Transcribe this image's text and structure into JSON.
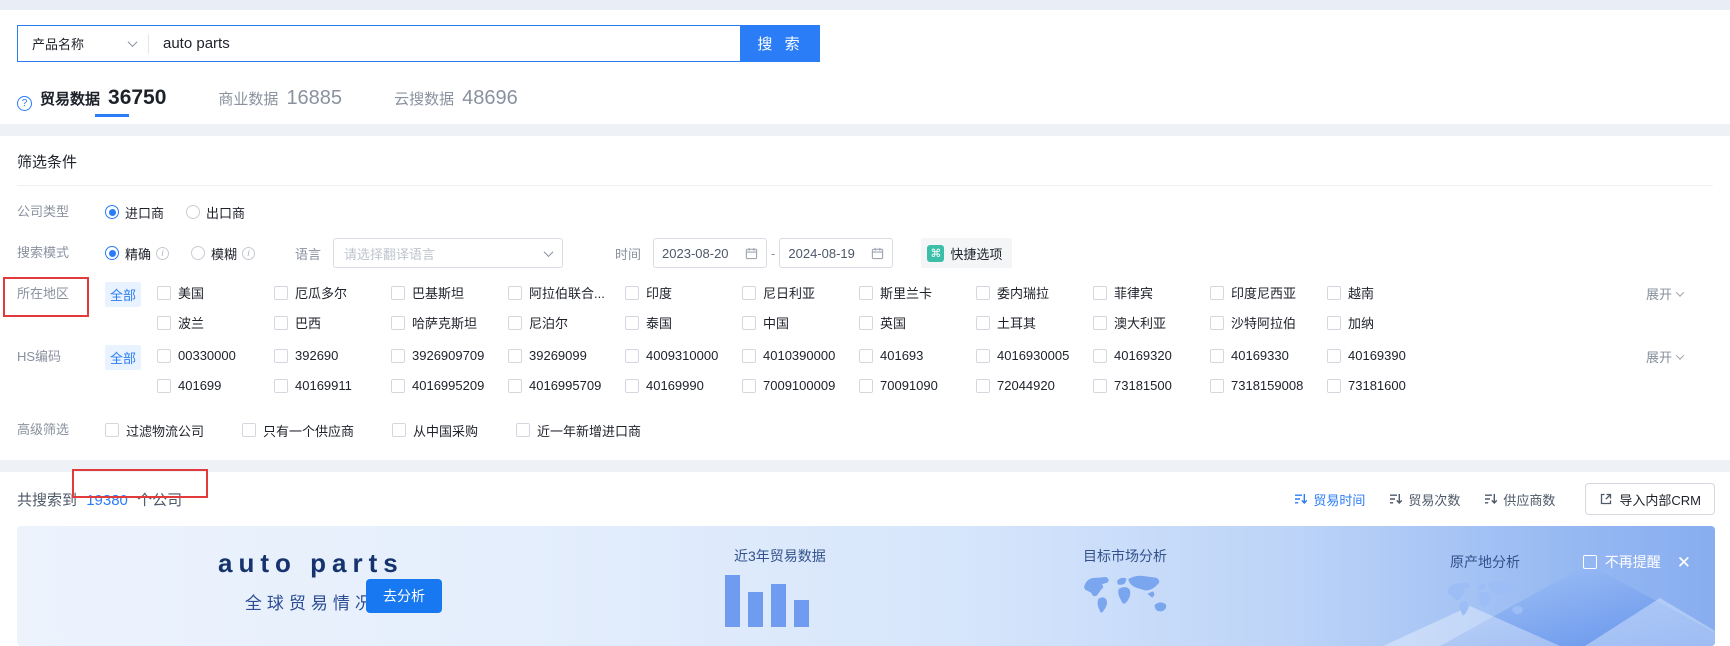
{
  "search": {
    "category": "产品名称",
    "query": "auto parts",
    "button": "搜 索"
  },
  "tabs": [
    {
      "label": "贸易数据",
      "count": "36750"
    },
    {
      "label": "商业数据",
      "count": "16885"
    },
    {
      "label": "云搜数据",
      "count": "48696"
    }
  ],
  "filter": {
    "title": "筛选条件",
    "company_type_label": "公司类型",
    "importer": "进口商",
    "exporter": "出口商",
    "search_mode_label": "搜索模式",
    "exact": "精确",
    "fuzzy": "模糊",
    "language_label": "语言",
    "language_placeholder": "请选择翻译语言",
    "time_label": "时间",
    "date_start": "2023-08-20",
    "date_separator": "-",
    "date_end": "2024-08-19",
    "quick_option": "快捷选项",
    "region_label": "所在地区",
    "all": "全部",
    "expand": "展开",
    "regions_row1": [
      "美国",
      "厄瓜多尔",
      "巴基斯坦",
      "阿拉伯联合...",
      "印度",
      "尼日利亚",
      "斯里兰卡",
      "委内瑞拉",
      "菲律宾",
      "印度尼西亚",
      "越南"
    ],
    "regions_row2": [
      "波兰",
      "巴西",
      "哈萨克斯坦",
      "尼泊尔",
      "泰国",
      "中国",
      "英国",
      "土耳其",
      "澳大利亚",
      "沙特阿拉伯",
      "加纳"
    ],
    "hs_label": "HS编码",
    "hs_row1": [
      "00330000",
      "392690",
      "3926909709",
      "39269099",
      "4009310000",
      "4010390000",
      "401693",
      "4016930005",
      "40169320",
      "40169330",
      "40169390"
    ],
    "hs_row2": [
      "401699",
      "40169911",
      "4016995209",
      "4016995709",
      "40169990",
      "7009100009",
      "70091090",
      "72044920",
      "73181500",
      "7318159008",
      "73181600"
    ],
    "advanced_label": "高级筛选",
    "advanced_options": [
      "过滤物流公司",
      "只有一个供应商",
      "从中国采购",
      "近一年新增进口商"
    ]
  },
  "results": {
    "prefix": "共搜索到",
    "count": "19380",
    "suffix": "个公司",
    "sort_trade_time": "贸易时间",
    "sort_trade_count": "贸易次数",
    "sort_supplier_count": "供应商数",
    "crm_button": "导入内部CRM"
  },
  "banner": {
    "title": "auto parts",
    "subtitle": "全球贸易情况",
    "analyze": "去分析",
    "card_trade": "近3年贸易数据",
    "card_market": "目标市场分析",
    "card_origin": "原产地分析",
    "dismiss": "不再提醒"
  },
  "colors": {
    "primary": "#2b7cf7",
    "teal": "#3bbfa9",
    "annotation": "#e23b3b"
  }
}
